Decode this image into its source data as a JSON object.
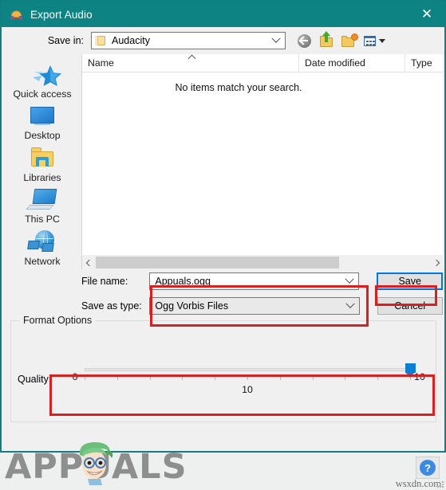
{
  "window": {
    "title": "Export Audio",
    "icon": "audacity-headphones-icon",
    "close_label": "✕",
    "accent_teal": "#0d8383",
    "focus_blue": "#0078d7",
    "annotation_red": "#d91f1f"
  },
  "savein": {
    "label": "Save in:",
    "value": "Audacity",
    "toolbar": [
      {
        "name": "back-icon",
        "tooltip": "Back"
      },
      {
        "name": "up-one-level-icon",
        "tooltip": "Up One Level"
      },
      {
        "name": "create-new-folder-icon",
        "tooltip": "Create New Folder"
      },
      {
        "name": "views-icon",
        "tooltip": "Views"
      }
    ]
  },
  "places": {
    "items": [
      {
        "label": "Quick access",
        "icon": "star-icon"
      },
      {
        "label": "Desktop",
        "icon": "monitor-icon"
      },
      {
        "label": "Libraries",
        "icon": "folder-library-icon"
      },
      {
        "label": "This PC",
        "icon": "computer-icon"
      },
      {
        "label": "Network",
        "icon": "network-globe-icon"
      }
    ]
  },
  "filelist": {
    "columns": [
      "Name",
      "Date modified",
      "Type"
    ],
    "sort_indicator": "ascending",
    "empty_message": "No items match your search.",
    "rows": [],
    "hscroll_thumb_percent": 73
  },
  "form": {
    "filename_label": "File name:",
    "filename_value": "Appuals.ogg",
    "filetype_label": "Save as type:",
    "filetype_value": "Ogg Vorbis Files",
    "save_button": "Save",
    "cancel_button": "Cancel"
  },
  "format_options": {
    "legend": "Format Options",
    "quality_label": "Quality:",
    "min": "0",
    "max": "10",
    "value": "10",
    "tick_count": 11
  },
  "watermark": {
    "logo_text": "APPUALS",
    "site": "wsxdn.com",
    "help_glyph": "?"
  }
}
